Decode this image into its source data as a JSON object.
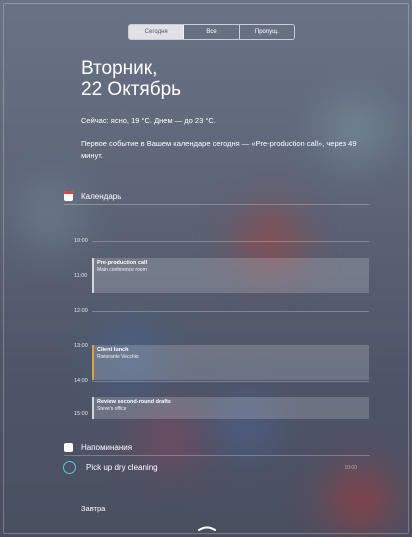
{
  "tabs": [
    {
      "label": "Сегодня",
      "active": true
    },
    {
      "label": "Все",
      "active": false
    },
    {
      "label": "Пропущ.",
      "active": false
    }
  ],
  "today": {
    "weekday": "Вторник,",
    "date": "22 Октябрь",
    "weather": "Сейчас: ясно, 19 °C. Днем — до 23 °C.",
    "first_event": "Первое событие в Вашем календаре сегодня — «Pre-production call», через 49 минут."
  },
  "calendar": {
    "title": "Календарь",
    "hours": [
      "10:00",
      "11:00",
      "12:00",
      "13:00",
      "14:00",
      "15:00"
    ],
    "events": [
      {
        "title": "Pre-production call",
        "location": "Main conference room"
      },
      {
        "title": "Client lunch",
        "location": "Ristorante Vecchio"
      },
      {
        "title": "Review second-round drafts",
        "location": "Steve's office"
      }
    ]
  },
  "reminders": {
    "title": "Напоминания",
    "items": [
      {
        "text": "Pick up dry cleaning",
        "time": "10:00"
      }
    ]
  },
  "tomorrow": {
    "label": "Завтра"
  },
  "colors": {
    "accent_teal": "#4bd0d6",
    "calendar_red": "#e0443c",
    "event_orange": "#d9a23d"
  },
  "icons": {
    "calendar": "calendar-icon",
    "reminders": "reminders-icon",
    "handle": "chevron-handle-icon"
  }
}
